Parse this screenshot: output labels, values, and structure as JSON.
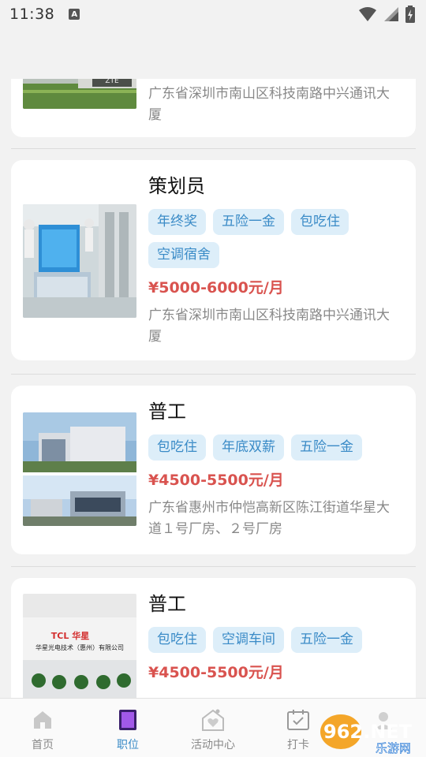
{
  "status_bar": {
    "time": "11:38",
    "badge": "A"
  },
  "jobs": [
    {
      "title": "",
      "tags": [],
      "salary": "",
      "address": "广东省深圳市南山区科技南路中兴通讯大厦"
    },
    {
      "title": "策划员",
      "tags": [
        "年终奖",
        "五险一金",
        "包吃住",
        "空调宿舍"
      ],
      "salary": "¥5000-6000元/月",
      "address": "广东省深圳市南山区科技南路中兴通讯大厦"
    },
    {
      "title": "普工",
      "tags": [
        "包吃住",
        "年底双薪",
        "五险一金"
      ],
      "salary": "¥4500-5500元/月",
      "address": "广东省惠州市仲恺高新区陈江街道华星大道１号厂房、２号厂房"
    },
    {
      "title": "普工",
      "tags": [
        "包吃住",
        "空调车间",
        "五险一金"
      ],
      "salary": "¥4500-5500元/月",
      "address": ""
    }
  ],
  "photo_text": {
    "building1_sign": "ZTE",
    "tcl_logo": "TCL 华星",
    "tcl_company": "华星光电技术（惠州）有限公司"
  },
  "nav": {
    "items": [
      {
        "label": "首页",
        "icon": "home-icon"
      },
      {
        "label": "职位",
        "icon": "job-icon"
      },
      {
        "label": "活动中心",
        "icon": "activity-icon"
      },
      {
        "label": "打卡",
        "icon": "calendar-icon"
      }
    ],
    "active_index": 1,
    "active_color": "#3a8bc7"
  },
  "watermark": {
    "brand": "962.NET",
    "sub": "乐游网"
  }
}
